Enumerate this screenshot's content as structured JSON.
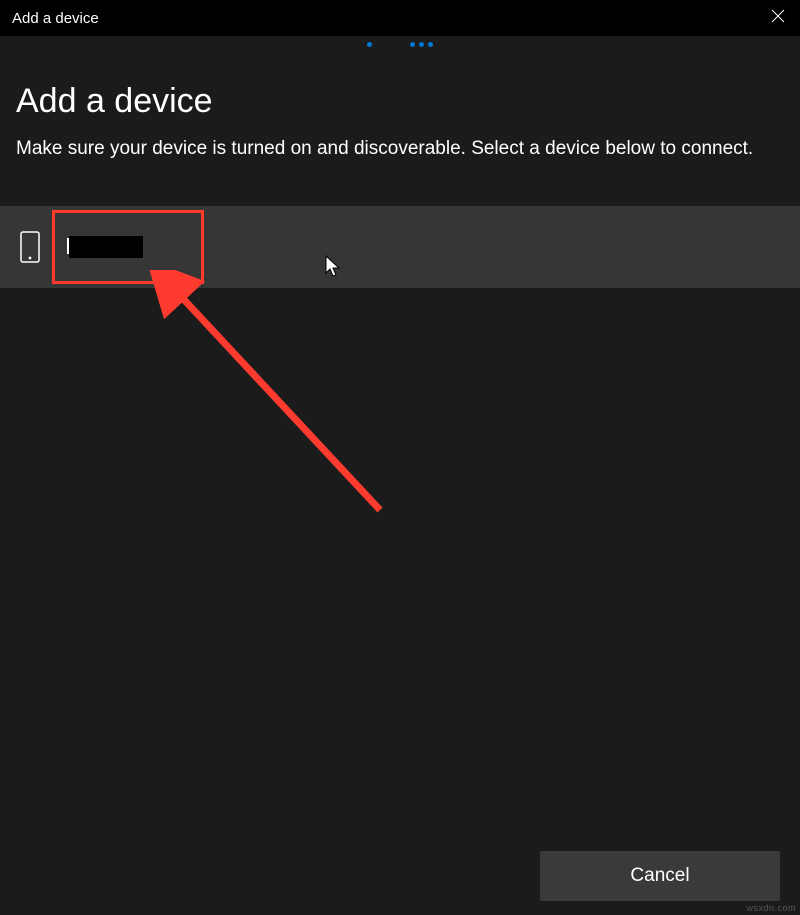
{
  "titlebar": {
    "title": "Add a device"
  },
  "dialog": {
    "heading": "Add a device",
    "subheading": "Make sure your device is turned on and discoverable. Select a device below to connect."
  },
  "devices": [
    {
      "icon": "phone-icon",
      "name": ""
    }
  ],
  "footer": {
    "cancel_label": "Cancel"
  },
  "watermark": "wsxdn.com"
}
